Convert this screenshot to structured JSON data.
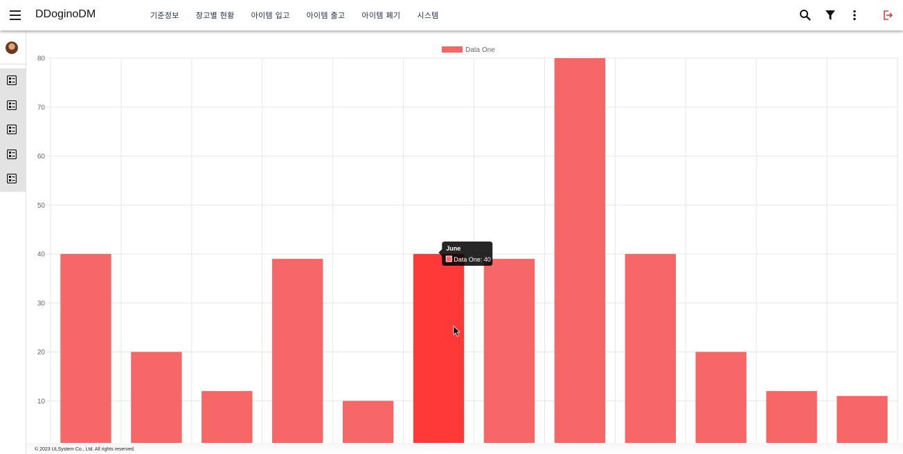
{
  "app": {
    "title": "DDoginoDM"
  },
  "nav": {
    "items": [
      "기준정보",
      "창고별 현황",
      "아이템 입고",
      "아이템 출고",
      "아이템 폐기",
      "시스템"
    ]
  },
  "toolbar": {
    "icons": [
      "search-icon",
      "filter-icon",
      "more-vert-icon",
      "logout-icon"
    ],
    "logout_color": "#e53935"
  },
  "sidebar": {
    "items": [
      "checklist-icon",
      "checklist-icon",
      "checklist-icon",
      "checklist-icon",
      "checklist-icon"
    ]
  },
  "chart_data": {
    "type": "bar",
    "categories": [
      "",
      "",
      "",
      "",
      "",
      "June",
      "",
      "",
      "",
      "",
      "",
      ""
    ],
    "series": [
      {
        "name": "Data One",
        "values": [
          40,
          20,
          12,
          39,
          10,
          40,
          39,
          80,
          40,
          20,
          12,
          11
        ]
      }
    ],
    "ylim": [
      0,
      80
    ],
    "yticks": [
      10,
      20,
      30,
      40,
      50,
      60,
      70,
      80
    ],
    "legend_position": "top",
    "grid": true,
    "bar_color": "#f56767",
    "hover_color": "#ff3838",
    "tooltip": {
      "index": 5,
      "title": "June",
      "text": "Data One: 40"
    }
  },
  "footer": {
    "text": "© 2023 ULSystem Co., Ltd. All rights reserved."
  }
}
